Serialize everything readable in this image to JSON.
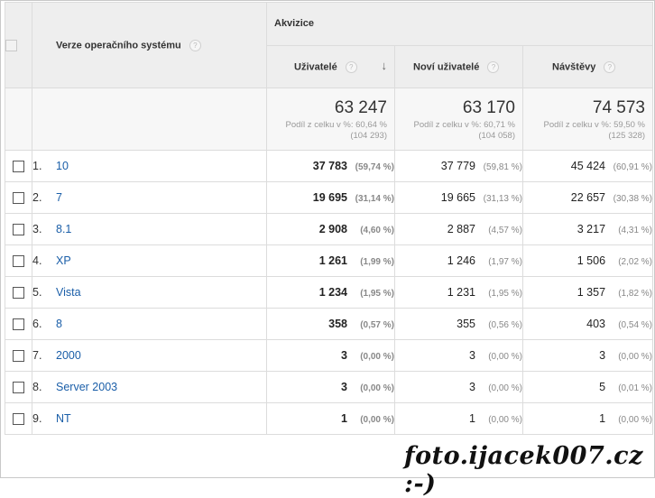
{
  "header": {
    "dimension_label": "Verze operačního systému",
    "group_label": "Akvizice",
    "columns": [
      "Uživatelé",
      "Noví uživatelé",
      "Návštěvy"
    ],
    "help_glyph": "?",
    "sort_glyph": "↓"
  },
  "totals": [
    {
      "value": "63 247",
      "pct_line": "Podíl z celku v %: 60,64 %",
      "total_line": "(104 293)"
    },
    {
      "value": "63 170",
      "pct_line": "Podíl z celku v %: 60,71 %",
      "total_line": "(104 058)"
    },
    {
      "value": "74 573",
      "pct_line": "Podíl z celku v %: 59,50 %",
      "total_line": "(125 328)"
    }
  ],
  "rows": [
    {
      "index": "1.",
      "name": "10",
      "users": "37 783",
      "users_pct": "(59,74 %)",
      "new_users": "37 779",
      "new_users_pct": "(59,81 %)",
      "sessions": "45 424",
      "sessions_pct": "(60,91 %)"
    },
    {
      "index": "2.",
      "name": "7",
      "users": "19 695",
      "users_pct": "(31,14 %)",
      "new_users": "19 665",
      "new_users_pct": "(31,13 %)",
      "sessions": "22 657",
      "sessions_pct": "(30,38 %)"
    },
    {
      "index": "3.",
      "name": "8.1",
      "users": "2 908",
      "users_pct": "(4,60 %)",
      "new_users": "2 887",
      "new_users_pct": "(4,57 %)",
      "sessions": "3 217",
      "sessions_pct": "(4,31 %)"
    },
    {
      "index": "4.",
      "name": "XP",
      "users": "1 261",
      "users_pct": "(1,99 %)",
      "new_users": "1 246",
      "new_users_pct": "(1,97 %)",
      "sessions": "1 506",
      "sessions_pct": "(2,02 %)"
    },
    {
      "index": "5.",
      "name": "Vista",
      "users": "1 234",
      "users_pct": "(1,95 %)",
      "new_users": "1 231",
      "new_users_pct": "(1,95 %)",
      "sessions": "1 357",
      "sessions_pct": "(1,82 %)"
    },
    {
      "index": "6.",
      "name": "8",
      "users": "358",
      "users_pct": "(0,57 %)",
      "new_users": "355",
      "new_users_pct": "(0,56 %)",
      "sessions": "403",
      "sessions_pct": "(0,54 %)"
    },
    {
      "index": "7.",
      "name": "2000",
      "users": "3",
      "users_pct": "(0,00 %)",
      "new_users": "3",
      "new_users_pct": "(0,00 %)",
      "sessions": "3",
      "sessions_pct": "(0,00 %)"
    },
    {
      "index": "8.",
      "name": "Server 2003",
      "users": "3",
      "users_pct": "(0,00 %)",
      "new_users": "3",
      "new_users_pct": "(0,00 %)",
      "sessions": "5",
      "sessions_pct": "(0,01 %)"
    },
    {
      "index": "9.",
      "name": "NT",
      "users": "1",
      "users_pct": "(0,00 %)",
      "new_users": "1",
      "new_users_pct": "(0,00 %)",
      "sessions": "1",
      "sessions_pct": "(0,00 %)"
    }
  ],
  "watermark": "foto.ijacek007.cz :-)",
  "colors": {
    "link": "#1a5ea8",
    "header_bg": "#eeeeee",
    "totals_bg": "#f7f7f7",
    "muted": "#888888"
  },
  "icons": {
    "help": "help-icon",
    "sort": "sort-descending-icon",
    "checkbox": "checkbox-icon"
  }
}
